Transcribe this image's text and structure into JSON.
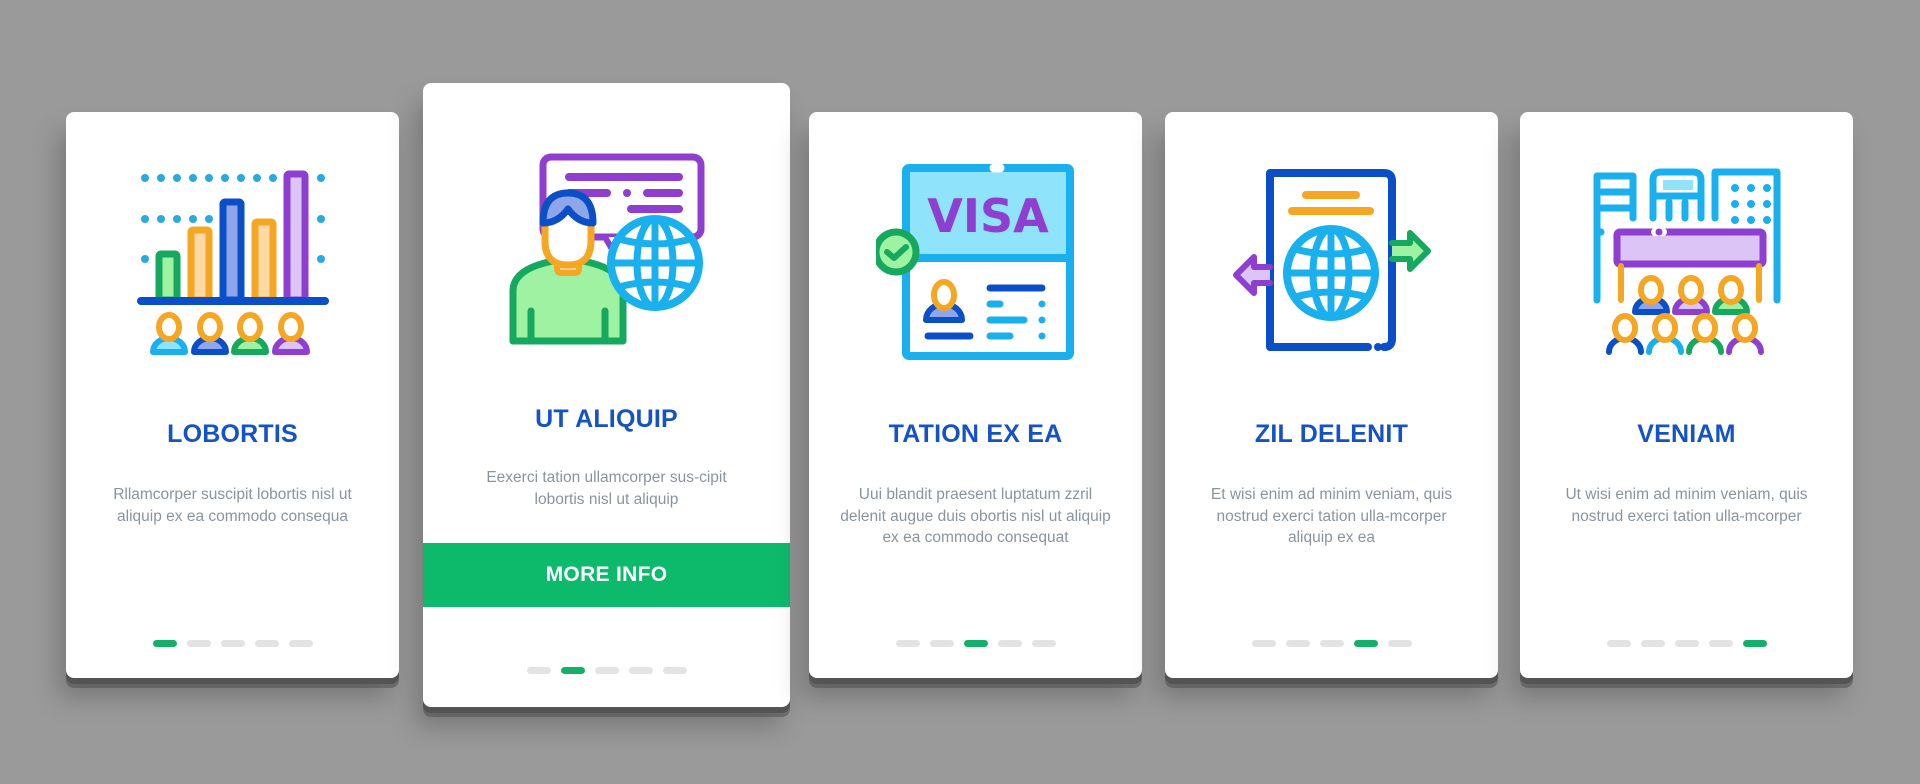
{
  "colors": {
    "background": "#9a9a9a",
    "card": "#ffffff",
    "title": "#1553c5",
    "description": "#8a949e",
    "accent_green": "#0dba6b",
    "dot_active": "#14b06a",
    "dot_inactive": "#e3e3e3"
  },
  "cards": [
    {
      "icon": "bar-chart-audience-icon",
      "title": "LOBORTIS",
      "description": "Rllamcorper suscipit lobortis nisl ut aliquip ex ea commodo consequa",
      "active_page": 1,
      "total_pages": 5
    },
    {
      "icon": "person-globe-speech-icon",
      "title": "UT ALIQUIP",
      "description": "Eexerci tation ullamcorper sus-cipit lobortis nisl ut aliquip",
      "button_label": "MORE INFO",
      "active_page": 2,
      "total_pages": 5
    },
    {
      "icon": "visa-document-icon",
      "icon_text": "VISA",
      "title": "TATION EX EA",
      "description": "Uui blandit praesent luptatum zzril delenit augue duis obortis nisl ut aliquip ex ea commodo consequat",
      "active_page": 3,
      "total_pages": 5
    },
    {
      "icon": "passport-globe-arrows-icon",
      "title": "ZIL DELENIT",
      "description": "Et wisi enim ad minim veniam, quis nostrud exerci tation ulla-mcorper aliquip ex ea",
      "active_page": 4,
      "total_pages": 5
    },
    {
      "icon": "city-conference-audience-icon",
      "title": "VENIAM",
      "description": "Ut wisi enim ad minim veniam, quis nostrud exerci tation ulla-mcorper",
      "active_page": 5,
      "total_pages": 5
    }
  ]
}
